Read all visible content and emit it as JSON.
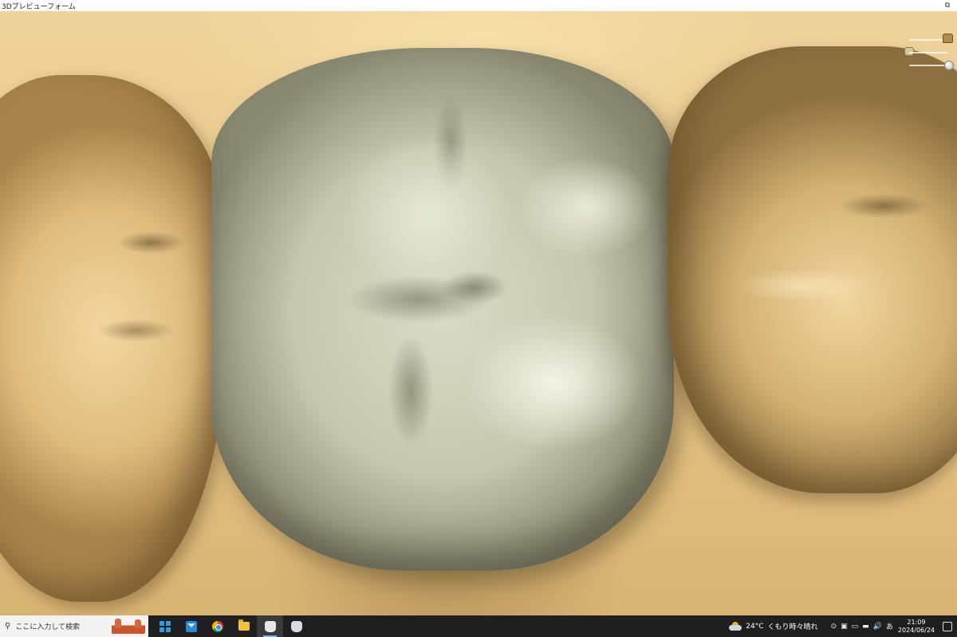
{
  "window": {
    "title": "3Dプレビューフォーム",
    "restore_glyph": "⧉"
  },
  "viewport": {
    "subject": "3D dental model",
    "view_controls": [
      {
        "name": "crown-opacity",
        "icon": "crown-icon"
      },
      {
        "name": "model-opacity",
        "icon": "model-icon"
      },
      {
        "name": "zoom",
        "icon": "knob-icon"
      }
    ]
  },
  "taskbar": {
    "search_placeholder": "ここに入力して検索",
    "search_glyph": "⚲",
    "apps": [
      {
        "name": "start",
        "icon": "windows-icon"
      },
      {
        "name": "mail",
        "icon": "mail-icon"
      },
      {
        "name": "chrome",
        "icon": "chrome-icon"
      },
      {
        "name": "explorer",
        "icon": "folder-icon"
      },
      {
        "name": "dental-app-1",
        "icon": "tooth-icon",
        "active": true
      },
      {
        "name": "dental-app-2",
        "icon": "tooth-icon"
      }
    ],
    "weather": {
      "temp": "24°C",
      "condition": "くもり時々晴れ"
    },
    "tray": {
      "icons": [
        "⊙",
        "▣",
        "▭",
        "▬",
        "🔊",
        "あ"
      ]
    },
    "clock": {
      "time": "21:09",
      "date": "2024/06/24"
    }
  },
  "colors": {
    "gingiva": "#e8c98c",
    "prep_crown": "#d9dbc7",
    "taskbar": "#1f1f1f"
  }
}
